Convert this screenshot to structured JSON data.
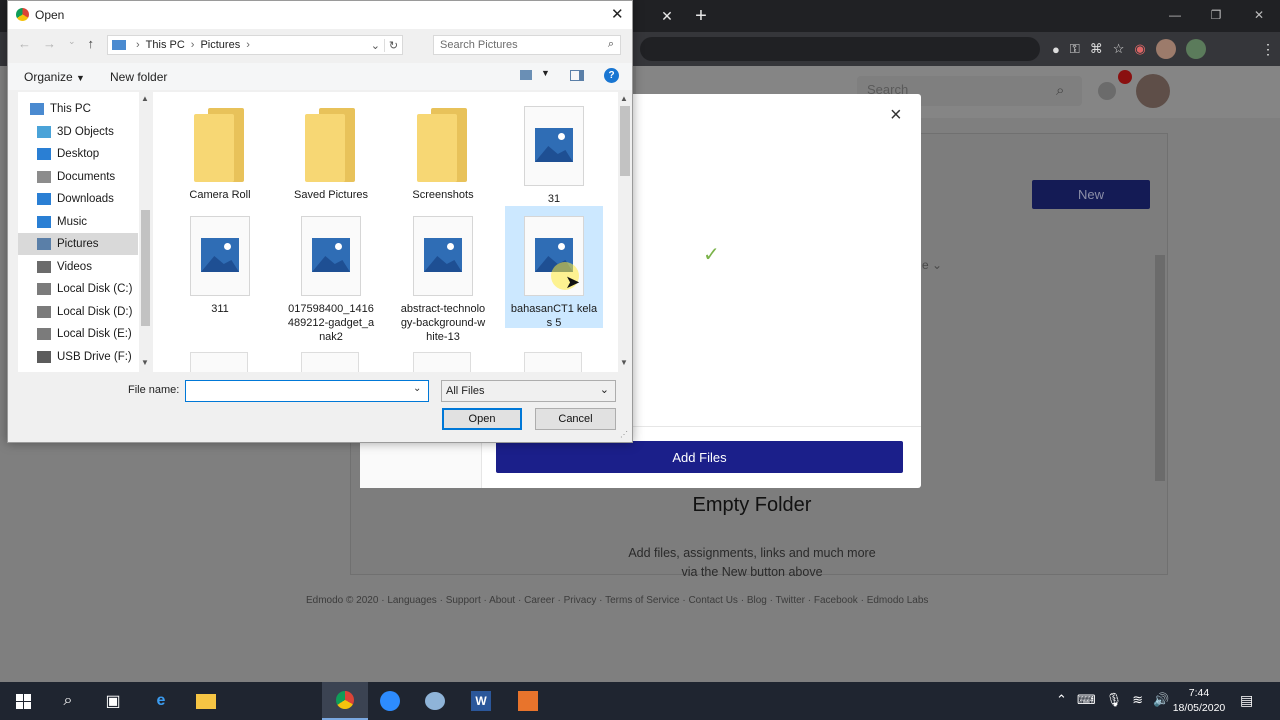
{
  "browser": {
    "new_tab": "+",
    "close_tab": "✕",
    "win_min": "—",
    "win_restore": "❐",
    "win_close": "✕",
    "menu": "⋮"
  },
  "site": {
    "search_placeholder": "Search",
    "new_button": "New",
    "modal_close": "×",
    "checkmark": "✓",
    "add_files": "Add Files",
    "empty_title": "Empty Folder",
    "empty_line1": "Add files, assignments, links and much more",
    "empty_line2": "via the New button above",
    "sort_fragment": "e",
    "notification_count": "",
    "footer": [
      "Edmodo © 2020",
      "Languages",
      "Support",
      "About",
      "Career",
      "Privacy",
      "Terms of Service",
      "Contact Us",
      "Blog",
      "Twitter",
      "Facebook",
      "Edmodo Labs"
    ]
  },
  "dialog": {
    "title": "Open",
    "close": "✕",
    "breadcrumb": [
      "This PC",
      "Pictures"
    ],
    "search_placeholder": "Search Pictures",
    "organize": "Organize",
    "new_folder": "New folder",
    "help": "?",
    "nav_items": [
      {
        "label": "This PC",
        "icon": "pc-icon"
      },
      {
        "label": "3D Objects",
        "icon": "cube-icon"
      },
      {
        "label": "Desktop",
        "icon": "desktop-icon"
      },
      {
        "label": "Documents",
        "icon": "document-icon"
      },
      {
        "label": "Downloads",
        "icon": "download-icon"
      },
      {
        "label": "Music",
        "icon": "music-icon"
      },
      {
        "label": "Pictures",
        "icon": "pictures-icon"
      },
      {
        "label": "Videos",
        "icon": "video-icon"
      },
      {
        "label": "Local Disk (C:)",
        "icon": "drive-icon"
      },
      {
        "label": "Local Disk (D:)",
        "icon": "drive-icon"
      },
      {
        "label": "Local Disk (E:)",
        "icon": "drive-icon"
      },
      {
        "label": "USB Drive (F:)",
        "icon": "usb-icon"
      }
    ],
    "files": [
      {
        "label": "Camera Roll",
        "type": "folder"
      },
      {
        "label": "Saved Pictures",
        "type": "folder"
      },
      {
        "label": "Screenshots",
        "type": "folder"
      },
      {
        "label": "31",
        "type": "image"
      },
      {
        "label": "311",
        "type": "image"
      },
      {
        "label": "017598400_1416489212-gadget_anak2",
        "type": "image"
      },
      {
        "label": "abstract-technology-background-white-13",
        "type": "image"
      },
      {
        "label": "bahasanCT1 kelas 5",
        "type": "image"
      }
    ],
    "file_name_label": "File name:",
    "file_name_value": "",
    "file_type": "All Files",
    "open_button": "Open",
    "cancel_button": "Cancel"
  },
  "taskbar": {
    "time": "7:44",
    "date": "18/05/2020"
  },
  "colors": {
    "accent_blue": "#1b1f8a",
    "selection": "#cce8ff",
    "folder_yellow": "#f7d774"
  }
}
